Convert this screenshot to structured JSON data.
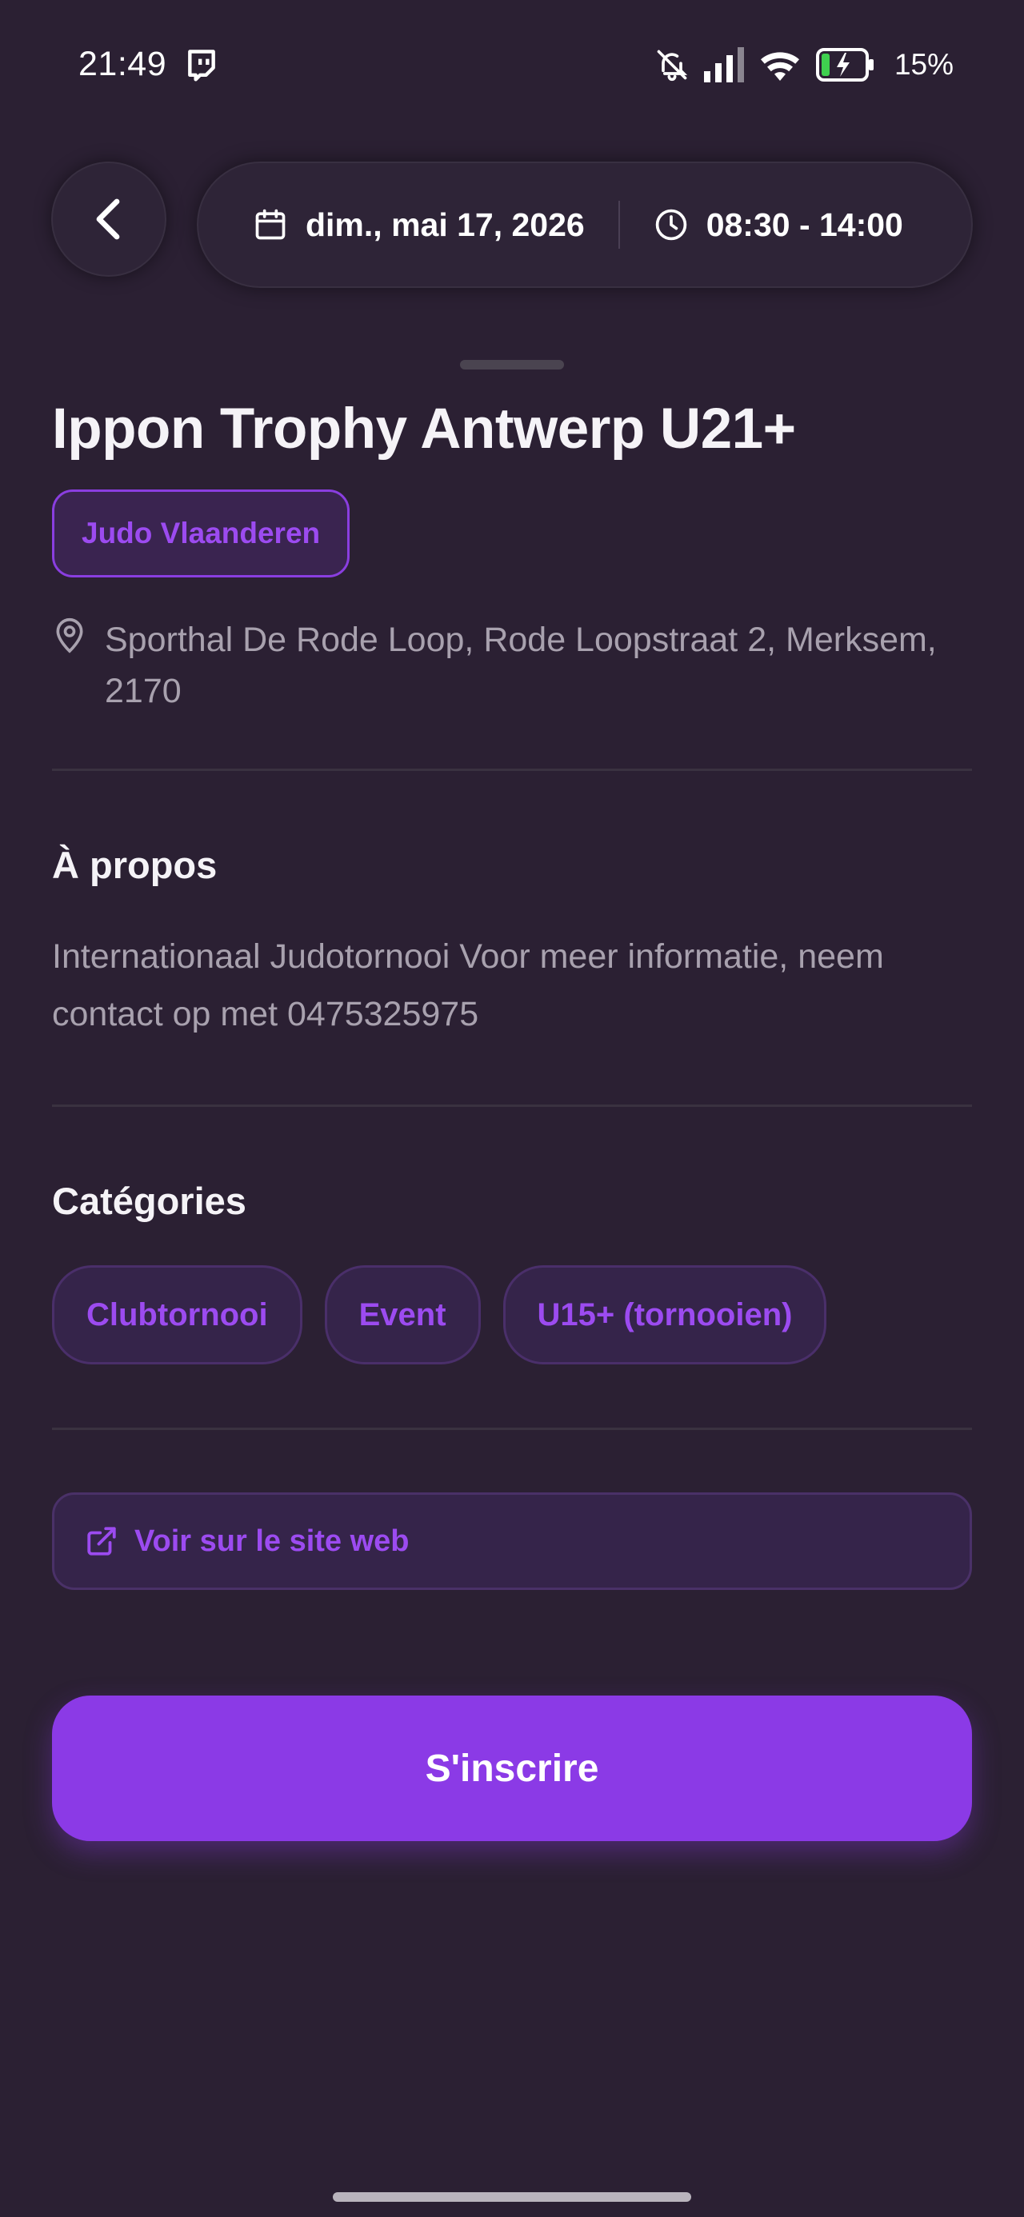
{
  "status_bar": {
    "time": "21:49",
    "battery_percent": "15%",
    "icons": [
      "twitch-icon",
      "bell-off-icon",
      "signal-icon",
      "wifi-icon",
      "battery-charging-icon"
    ]
  },
  "header": {
    "date": "dim., mai 17, 2026",
    "time_range": "08:30 - 14:00"
  },
  "event": {
    "title": "Ippon Trophy Antwerp U21+",
    "organizer": "Judo Vlaanderen",
    "location": "Sporthal De Rode Loop, Rode Loopstraat 2, Merksem, 2170"
  },
  "about": {
    "heading": "À propos",
    "text": "Internationaal Judotornooi Voor meer informatie, neem contact op met  0475325975"
  },
  "categories": {
    "heading": "Catégories",
    "items": [
      "Clubtornooi",
      "Event",
      "U15+ (tornooien)"
    ]
  },
  "actions": {
    "website_label": "Voir sur le site web",
    "register_label": "S'inscrire"
  },
  "colors": {
    "background": "#2b2033",
    "accent": "#8b3ae6",
    "accent_text": "#9c4bf0",
    "muted_text": "#a8a1ae"
  }
}
